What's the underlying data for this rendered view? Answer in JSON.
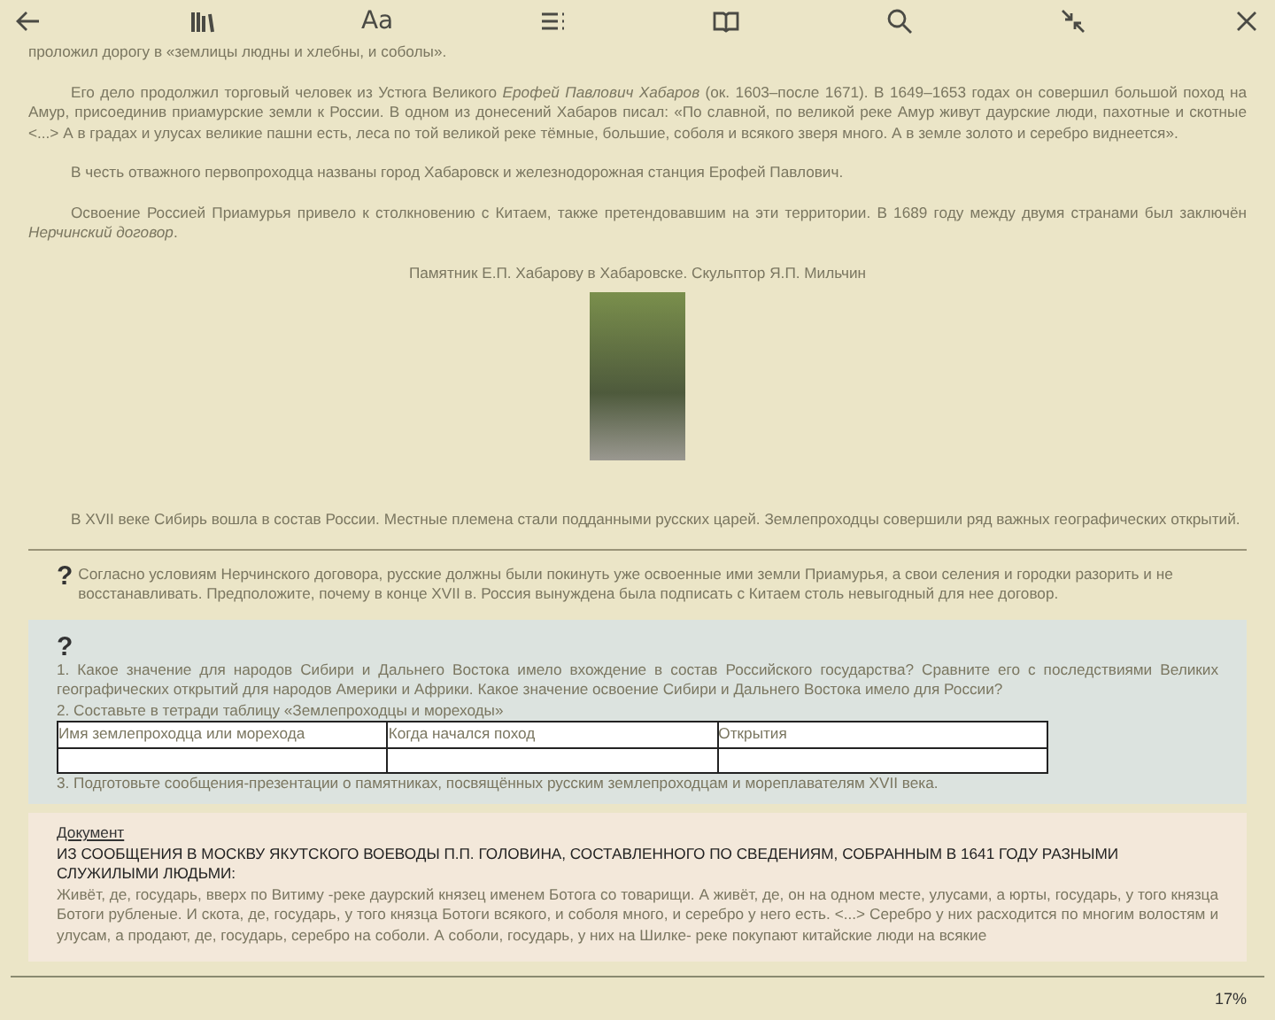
{
  "toolbar": {
    "font_label": "Aa"
  },
  "paragraphs": [
    {
      "kind": "continued",
      "text": "проложил дорогу в «землицы людны и хлебны, и соболы»."
    },
    {
      "kind": "indented",
      "text": "Его дело продолжил торговый человек из Устюга Великого *Ерофей Павлович Хабаров* (ок. 1603–после 1671). В 1649–1653 годах он совершил большой поход на Амур, присоединив приамурские земли к России. В одном из донесений Хабаров писал: «По славной, по великой реке Амур живут даурские люди, пахотные и скотные <...> А в градах и улусах великие пашни есть, леса по той великой реке тёмные, большие, соболя и всякого зверя много. А в земле золото и серебро виднеется»."
    },
    {
      "kind": "indented",
      "text": "В честь отважного первопроходца названы город Хабаровск и железнодорожная станция Ерофей Павлович."
    },
    {
      "kind": "indented",
      "text": "Освоение Россией Приамурья привело к столкновению с Китаем, также претендовавшим на эти территории. В 1689 году между двумя странами был заключён *Нерчинский договор*."
    }
  ],
  "figure": {
    "caption": "Памятник Е.П. Хабарову в Хабаровске. Скульптор Я.П. Мильчин"
  },
  "after_paragraph": "В XVII веке Сибирь вошла в состав России. Местные племена стали подданными русских царей. Землепроходцы совершили ряд важных географических открытий.",
  "question": {
    "mark": "?",
    "text": "Согласно условиям Нерчинского договора, русские должны были покинуть уже освоенные ими земли Приамурья, а свои селения и городки разорить и не восстанавливать. Предположите, почему в конце XVII в. Россия вынуждена была подписать с Китаем столь невыгодный для нее договор."
  },
  "tasks": {
    "mark": "?",
    "items_before": [
      "1. Какое значение для народов Сибири и Дальнего Востока имело вхождение в состав Российского государства? Сравните его с последствиями Великих географических открытий для народов Америки и Африки. Какое значение освоение Сибири и Дальнего Востока имело для России?",
      "2. Составьте в тетради таблицу «Землепроходцы и мореходы»"
    ],
    "table_columns": [
      "Имя землепроходца или морехода",
      "Когда начался поход",
      "Открытия"
    ],
    "items_after": [
      "3. Подготовьте сообщения-презентации о памятниках, посвящённых русским землепроходцам и мореплавателям XVII века."
    ]
  },
  "document": {
    "label": "Документ",
    "heading": "ИЗ СООБЩЕНИЯ В МОСКВУ ЯКУТСКОГО ВОЕВОДЫ П.П. ГОЛОВИНА, СОСТАВЛЕННОГО ПО СВЕДЕНИЯМ, СОБРАННЫМ В 1641 ГОДУ РАЗНЫМИ СЛУЖИЛЫМИ ЛЮДЬМИ:",
    "text": "Живёт, де, государь, вверх по Витиму -реке даурский князец именем Ботога со товарищи. А живёт, де, он на одном месте, улусами, а юрты, государь, у того князца Ботоги рубленые. И скота, де, государь, у того князца Ботоги всякого, и соболя много, и серебро у него есть. <...> Серебро у них расходится по многим волостям и улусам, а продают, де, государь, серебро на соболи. А соболи, государь, у них на Шилке- реке покупают китайские люди на всякие"
  },
  "status_bar": {
    "progress": "17%"
  }
}
